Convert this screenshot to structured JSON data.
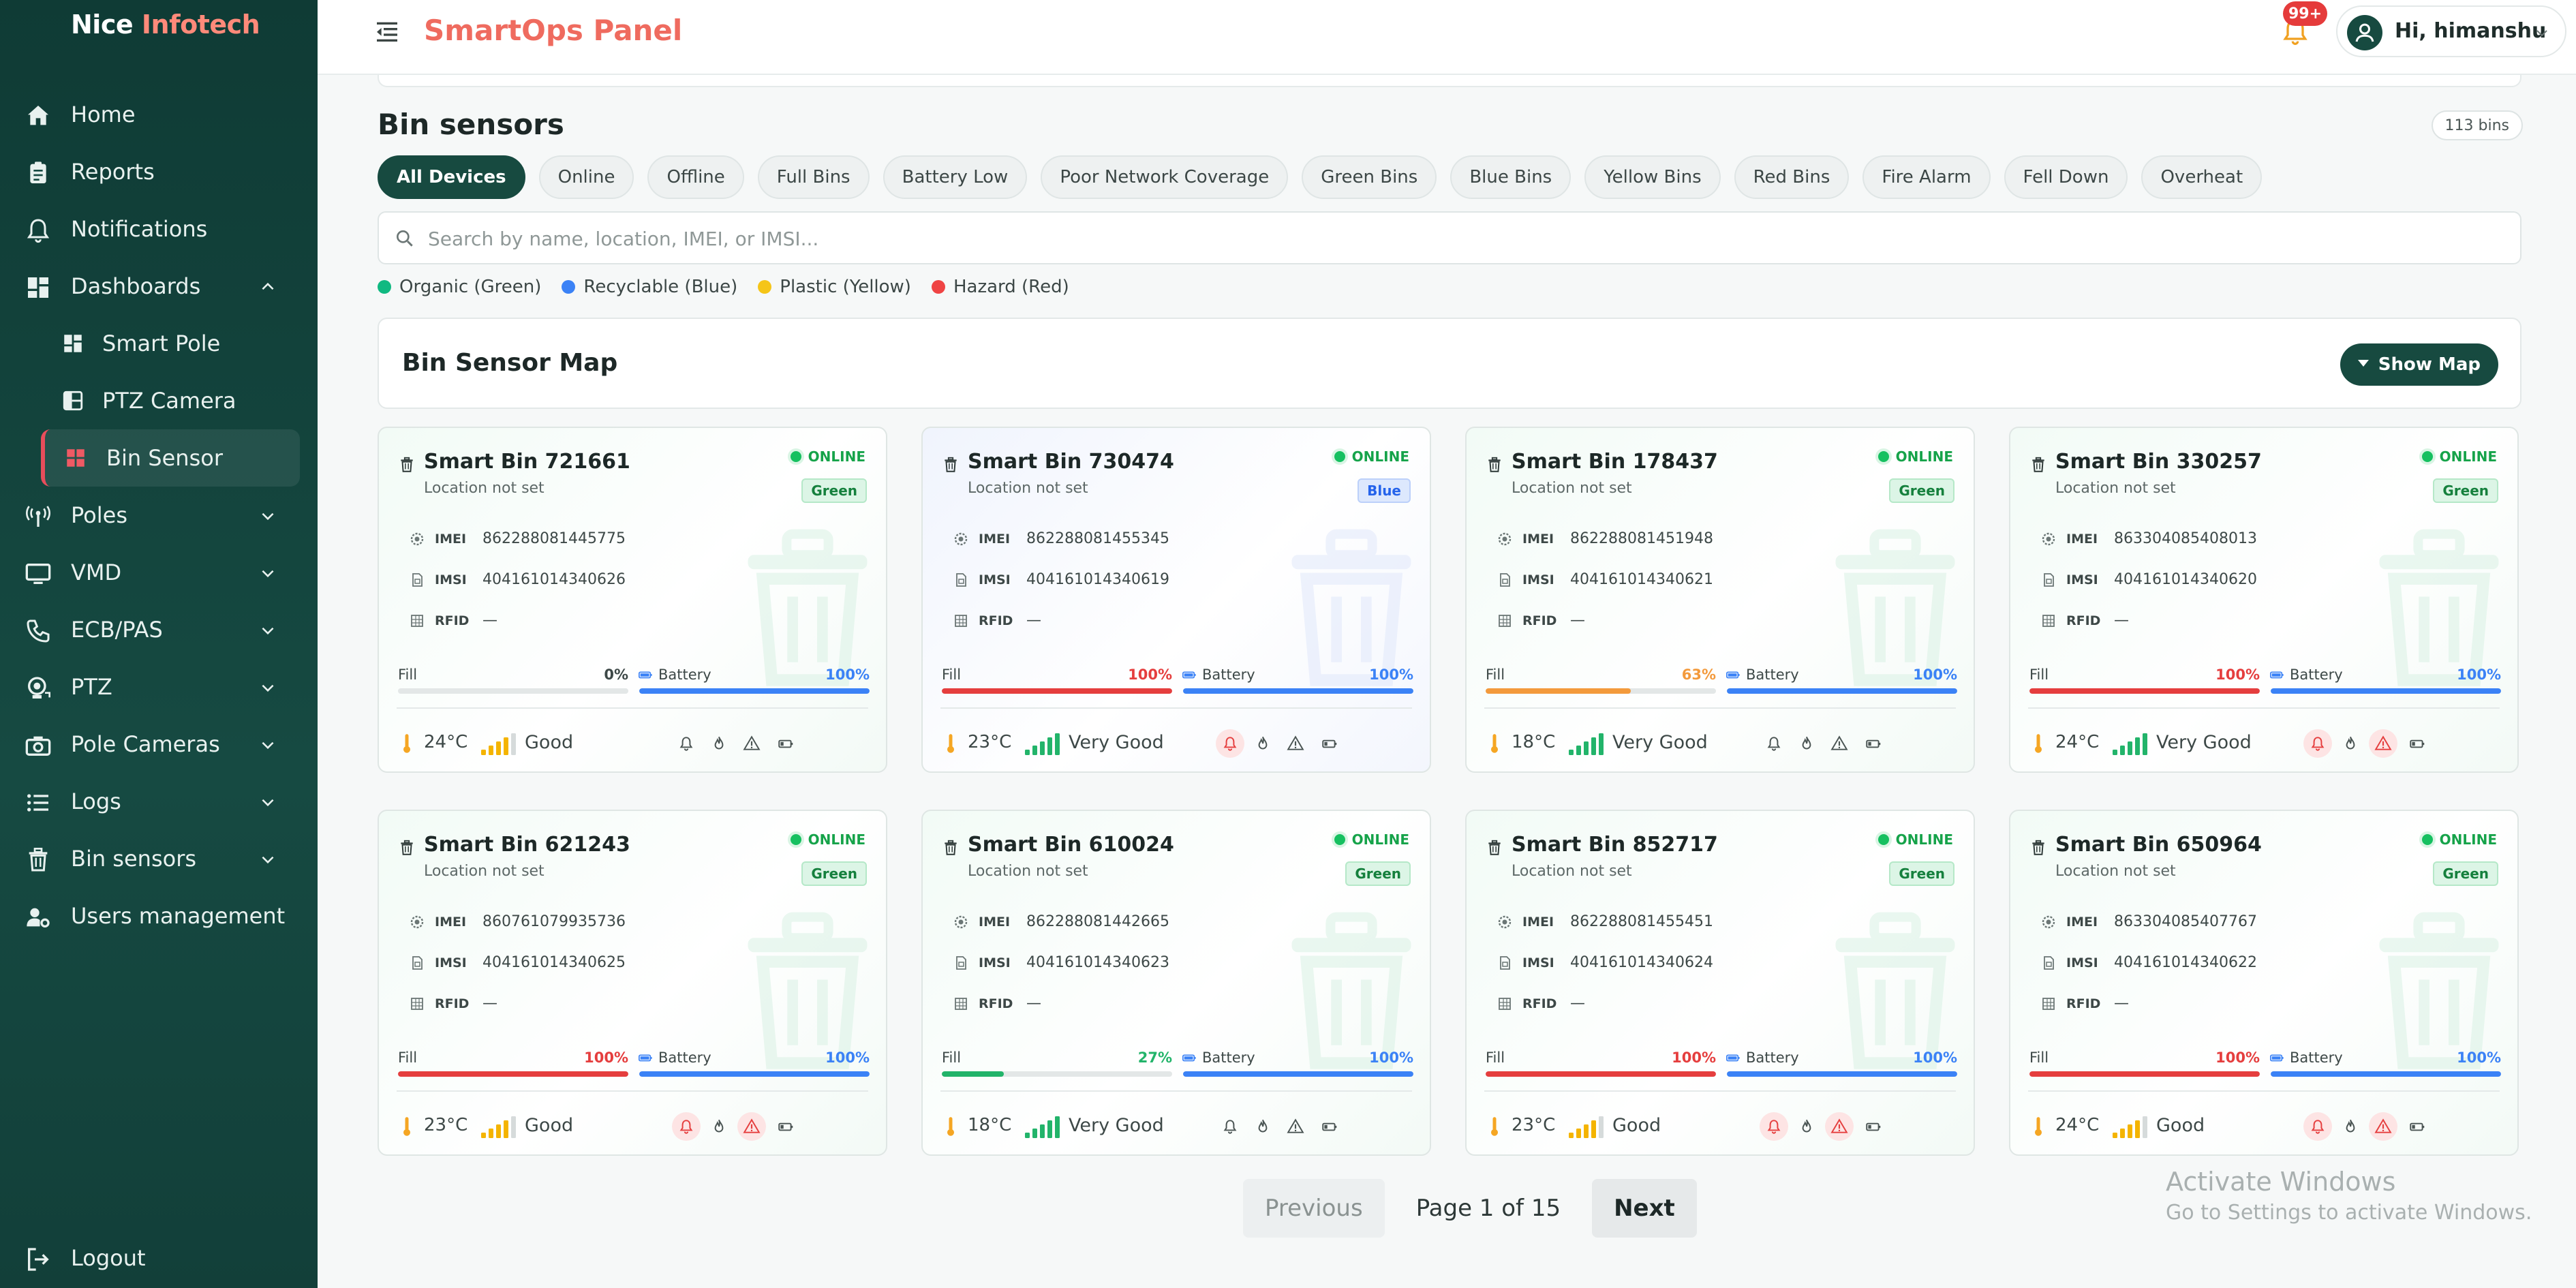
{
  "brand": {
    "part1": "Nice",
    "part2": "Infotech"
  },
  "header": {
    "title": "SmartOps Panel",
    "notif_badge": "99+",
    "user_greeting": "Hi, himanshu"
  },
  "sidebar": {
    "items": [
      {
        "label": "Home"
      },
      {
        "label": "Reports"
      },
      {
        "label": "Notifications"
      },
      {
        "label": "Dashboards"
      },
      {
        "label": "Smart Pole"
      },
      {
        "label": "PTZ Camera"
      },
      {
        "label": "Bin Sensor"
      },
      {
        "label": "Poles"
      },
      {
        "label": "VMD"
      },
      {
        "label": "ECB/PAS"
      },
      {
        "label": "PTZ"
      },
      {
        "label": "Pole Cameras"
      },
      {
        "label": "Logs"
      },
      {
        "label": "Bin sensors"
      },
      {
        "label": "Users management"
      }
    ],
    "logout": "Logout"
  },
  "main": {
    "title": "Bin sensors",
    "count": "113 bins",
    "filters": [
      "All Devices",
      "Online",
      "Offline",
      "Full Bins",
      "Battery Low",
      "Poor Network Coverage",
      "Green Bins",
      "Blue Bins",
      "Yellow Bins",
      "Red Bins",
      "Fire Alarm",
      "Fell Down",
      "Overheat"
    ],
    "search_placeholder": "Search by name, location, IMEI, or IMSI...",
    "legend": [
      {
        "label": "Organic (Green)",
        "color": "#10b981"
      },
      {
        "label": "Recyclable (Blue)",
        "color": "#3b82f6"
      },
      {
        "label": "Plastic (Yellow)",
        "color": "#f5c518"
      },
      {
        "label": "Hazard (Red)",
        "color": "#ef4444"
      }
    ],
    "map_title": "Bin Sensor Map",
    "map_button": "Show Map"
  },
  "card_labels": {
    "location": "Location not set",
    "imei": "IMEI",
    "imsi": "IMSI",
    "rfid": "RFID",
    "fill": "Fill",
    "battery": "Battery",
    "status": "ONLINE"
  },
  "cards": [
    {
      "name": "Smart Bin 721661",
      "tag": "Green",
      "imei": "862288081445775",
      "imsi": "404161014340626",
      "rfid": "—",
      "fill": "0%",
      "fill_value": 0,
      "battery": "100%",
      "battery_value": 100,
      "temp": "24°C",
      "signal": "Good",
      "alerts": [
        false,
        false,
        false
      ]
    },
    {
      "name": "Smart Bin 730474",
      "tag": "Blue",
      "imei": "862288081455345",
      "imsi": "404161014340619",
      "rfid": "—",
      "fill": "100%",
      "fill_value": 100,
      "battery": "100%",
      "battery_value": 100,
      "temp": "23°C",
      "signal": "Very Good",
      "alerts": [
        true,
        false,
        false
      ]
    },
    {
      "name": "Smart Bin 178437",
      "tag": "Green",
      "imei": "862288081451948",
      "imsi": "404161014340621",
      "rfid": "—",
      "fill": "63%",
      "fill_value": 63,
      "battery": "100%",
      "battery_value": 100,
      "temp": "18°C",
      "signal": "Very Good",
      "alerts": [
        false,
        false,
        false
      ]
    },
    {
      "name": "Smart Bin 330257",
      "tag": "Green",
      "imei": "863304085408013",
      "imsi": "404161014340620",
      "rfid": "—",
      "fill": "100%",
      "fill_value": 100,
      "battery": "100%",
      "battery_value": 100,
      "temp": "24°C",
      "signal": "Very Good",
      "alerts": [
        true,
        false,
        true
      ]
    },
    {
      "name": "Smart Bin 621243",
      "tag": "Green",
      "imei": "860761079935736",
      "imsi": "404161014340625",
      "rfid": "—",
      "fill": "100%",
      "fill_value": 100,
      "battery": "100%",
      "battery_value": 100,
      "temp": "23°C",
      "signal": "Good",
      "alerts": [
        true,
        false,
        true
      ]
    },
    {
      "name": "Smart Bin 610024",
      "tag": "Green",
      "imei": "862288081442665",
      "imsi": "404161014340623",
      "rfid": "—",
      "fill": "27%",
      "fill_value": 27,
      "battery": "100%",
      "battery_value": 100,
      "temp": "18°C",
      "signal": "Very Good",
      "alerts": [
        false,
        false,
        false
      ]
    },
    {
      "name": "Smart Bin 852717",
      "tag": "Green",
      "imei": "862288081455451",
      "imsi": "404161014340624",
      "rfid": "—",
      "fill": "100%",
      "fill_value": 100,
      "battery": "100%",
      "battery_value": 100,
      "temp": "23°C",
      "signal": "Good",
      "alerts": [
        true,
        false,
        true
      ]
    },
    {
      "name": "Smart Bin 650964",
      "tag": "Green",
      "imei": "863304085407767",
      "imsi": "404161014340622",
      "rfid": "—",
      "fill": "100%",
      "fill_value": 100,
      "battery": "100%",
      "battery_value": 100,
      "temp": "24°C",
      "signal": "Good",
      "alerts": [
        true,
        false,
        true
      ]
    }
  ],
  "colors": {
    "fill_full": "#e53e3e",
    "fill_mid": "#f39a3c",
    "fill_low": "#22b46a",
    "battery": "#3b82f6",
    "signal_good": "#f4b400",
    "signal_very_good": "#22b46a"
  },
  "pagination": {
    "previous": "Previous",
    "page_text": "Page 1 of 15",
    "next": "Next"
  },
  "watermark": {
    "line1": "Activate Windows",
    "line2": "Go to Settings to activate Windows."
  }
}
